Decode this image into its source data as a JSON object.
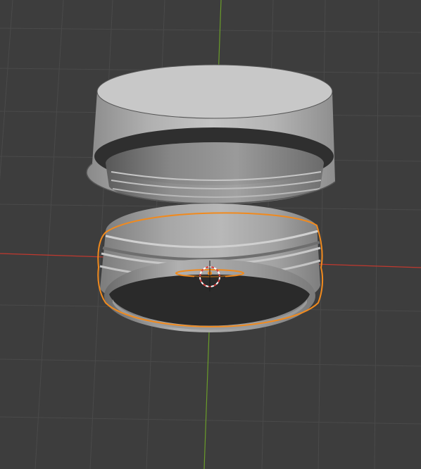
{
  "viewport": {
    "background": "#3d3d3d",
    "grid_color": "#4a4a4a",
    "x_axis_color": "#c0392f",
    "y_axis_color": "#6a9c2a"
  },
  "objects": [
    {
      "name": "outer-ring",
      "selected": false,
      "color": "#9a9a9a"
    },
    {
      "name": "threaded-ring",
      "selected": true,
      "color": "#9a9a9a",
      "outline_color": "#f08a1e"
    }
  ],
  "cursor": {
    "icon": "3d-cursor-icon",
    "color": "#d94040"
  },
  "origin": {
    "icon": "origin-point-icon",
    "color": "#f08a1e"
  }
}
